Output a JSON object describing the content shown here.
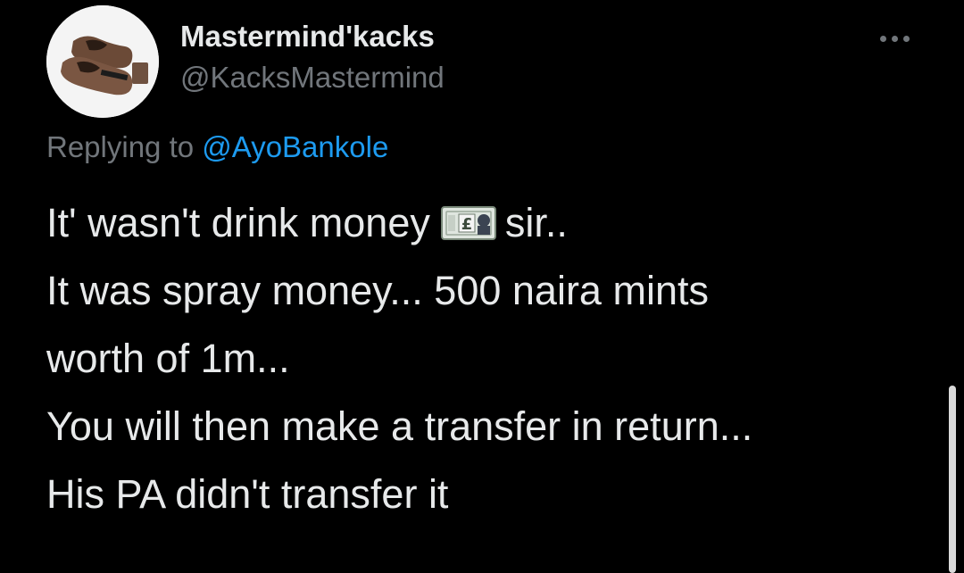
{
  "tweet": {
    "display_name": "Mastermind'kacks",
    "handle": "@KacksMastermind",
    "avatar_icon": "shoes-avatar-icon",
    "more_icon": "more-options-icon",
    "replying_prefix": "Replying to",
    "replying_to": "@AyoBankole",
    "lines": {
      "line1_before": "It' wasn't drink money",
      "line1_after": "sir..",
      "line2": "It was spray money... 500 naira mints",
      "line3": "worth of 1m...",
      "line4": "You will then make a transfer in  return...",
      "line5": "His PA didn't transfer it"
    },
    "emoji": "pound-banknote-icon"
  },
  "colors": {
    "background": "#000000",
    "text": "#e7e9ea",
    "secondary": "#71767b",
    "link": "#1d9bf0"
  }
}
